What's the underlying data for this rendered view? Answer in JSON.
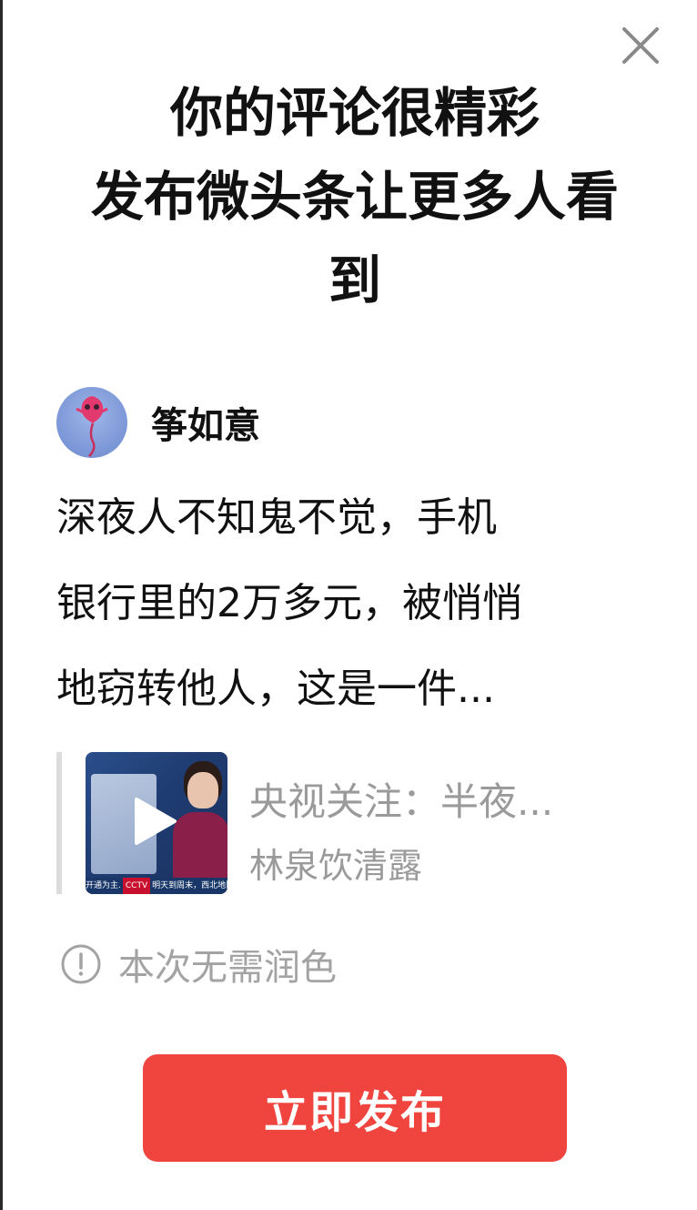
{
  "header": {
    "title_line1": "你的评论很精彩",
    "title_line2": "发布微头条让更多人看",
    "title_line3": "到"
  },
  "author": {
    "name": "筝如意"
  },
  "post": {
    "line1": "深夜人不知鬼不觉，手机",
    "line2": "银行里的2万多元，被悄悄",
    "line3": "地窃转他人，这是一件..."
  },
  "quoted": {
    "title": "央视关注：半夜...",
    "source": "林泉饮清露",
    "thumb_ticker_left": "开通为主.",
    "thumb_ticker_logo": "CCTV",
    "thumb_ticker_right": "明天到周末，西北地区"
  },
  "notice": {
    "text": "本次无需润色"
  },
  "actions": {
    "publish_label": "立即发布"
  },
  "colors": {
    "accent": "#f0443f",
    "muted_text": "#9a9a9a",
    "primary_text": "#111111"
  },
  "icons": {
    "close": "close-icon",
    "play": "play-icon",
    "notice": "exclamation-circle-icon"
  }
}
